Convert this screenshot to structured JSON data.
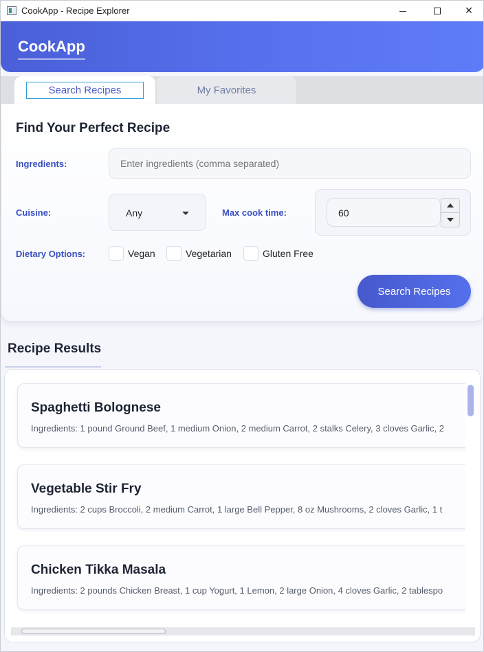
{
  "window": {
    "title": "CookApp - Recipe Explorer"
  },
  "header": {
    "brand": "CookApp"
  },
  "tabs": [
    {
      "label": "Search Recipes",
      "active": true
    },
    {
      "label": "My Favorites",
      "active": false
    }
  ],
  "search": {
    "heading": "Find Your Perfect Recipe",
    "ingredients_label": "Ingredients:",
    "ingredients_placeholder": "Enter ingredients (comma separated)",
    "ingredients_value": "",
    "cuisine_label": "Cuisine:",
    "cuisine_value": "Any",
    "max_time_label": "Max cook time:",
    "max_time_value": "60",
    "dietary_label": "Dietary Options:",
    "dietary_options": [
      {
        "label": "Vegan",
        "checked": false
      },
      {
        "label": "Vegetarian",
        "checked": false
      },
      {
        "label": "Gluten Free",
        "checked": false
      }
    ],
    "button_label": "Search Recipes"
  },
  "results": {
    "heading": "Recipe Results",
    "items": [
      {
        "title": "Spaghetti Bolognese",
        "ingredients": "Ingredients: 1 pound Ground Beef, 1 medium Onion, 2 medium Carrot, 2 stalks Celery, 3 cloves Garlic, 2"
      },
      {
        "title": "Vegetable Stir Fry",
        "ingredients": "Ingredients: 2 cups Broccoli, 2 medium Carrot, 1 large Bell Pepper, 8 oz Mushrooms, 2 cloves Garlic, 1 t"
      },
      {
        "title": "Chicken Tikka Masala",
        "ingredients": "Ingredients: 2 pounds Chicken Breast, 1 cup Yogurt, 1  Lemon, 2 large Onion, 4 cloves Garlic, 2 tablespo"
      }
    ]
  },
  "colors": {
    "accent": "#4a5fd8",
    "label": "#3a4fc0",
    "focus": "#2f9fd6"
  }
}
